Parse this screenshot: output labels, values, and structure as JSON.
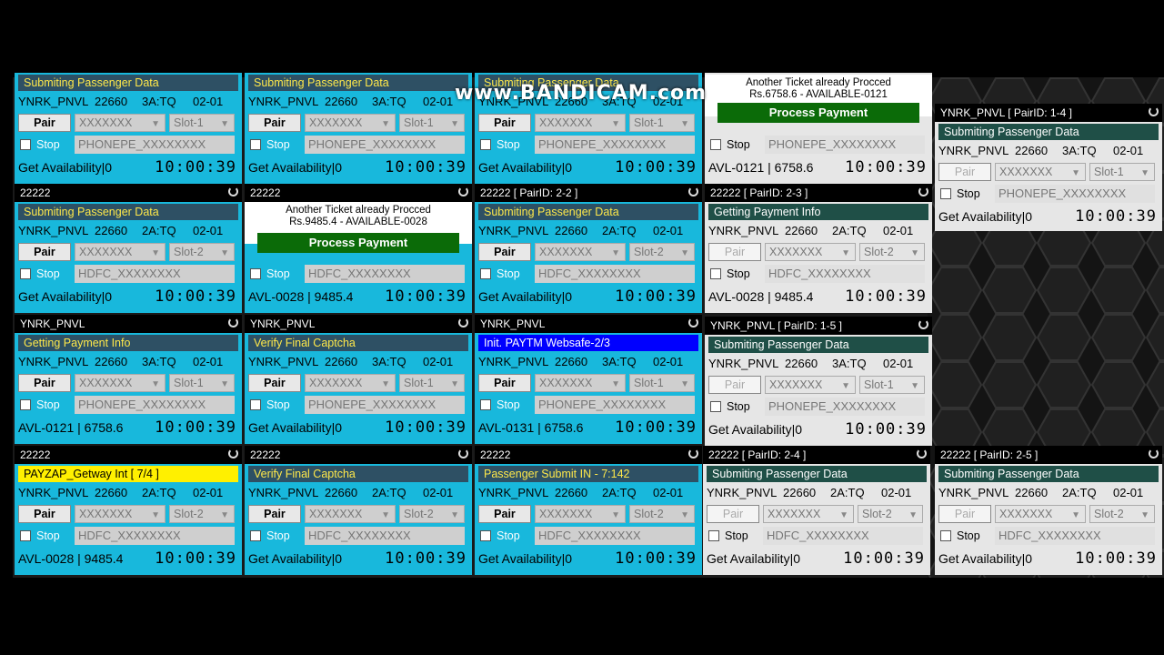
{
  "watermark": "www.BANDICAM.com",
  "panels": [
    {
      "title": "",
      "status": "Submiting Passenger Data",
      "station": "YNRK_PNVL",
      "train": "22660",
      "cls": "3A:TQ",
      "date": "02-01",
      "pair": "Pair",
      "user": "XXXXXXX",
      "slot": "Slot-1",
      "stop": "Stop",
      "bank": "PHONEPE_XXXXXXXX",
      "left": "Get Availability|0",
      "timer": "10:00:39"
    },
    {
      "title": "",
      "status": "Submiting Passenger Data",
      "station": "YNRK_PNVL",
      "train": "22660",
      "cls": "3A:TQ",
      "date": "02-01",
      "pair": "Pair",
      "user": "XXXXXXX",
      "slot": "Slot-1",
      "stop": "Stop",
      "bank": "PHONEPE_XXXXXXXX",
      "left": "Get Availability|0",
      "timer": "10:00:39"
    },
    {
      "title": "",
      "status": "Submiting Passenger Data",
      "station": "YNRK_PNVL",
      "train": "22660",
      "cls": "3A:TQ",
      "date": "02-01",
      "pair": "Pair",
      "user": "XXXXXXX",
      "slot": "Slot-1",
      "stop": "Stop",
      "bank": "PHONEPE_XXXXXXXX",
      "left": "Get Availability|0",
      "timer": "10:00:39"
    },
    {
      "title": "",
      "alert1": "Another Ticket already Procced",
      "alert2": "Rs.6758.6 - AVAILABLE-0121",
      "process": "Process Payment",
      "stop": "Stop",
      "bank": "PHONEPE_XXXXXXXX",
      "left": "AVL-0121 | 6758.6",
      "timer": "10:00:39"
    },
    {
      "title": "YNRK_PNVL [ PairID: 1-4 ]",
      "status": "Submiting Passenger Data",
      "station": "YNRK_PNVL",
      "train": "22660",
      "cls": "3A:TQ",
      "date": "02-01",
      "pair": "Pair",
      "user": "XXXXXXX",
      "slot": "Slot-1",
      "stop": "Stop",
      "bank": "PHONEPE_XXXXXXXX",
      "left": "Get Availability|0",
      "timer": "10:00:39"
    },
    {
      "title": "22222",
      "status": "Submiting Passenger Data",
      "station": "YNRK_PNVL",
      "train": "22660",
      "cls": "2A:TQ",
      "date": "02-01",
      "pair": "Pair",
      "user": "XXXXXXX",
      "slot": "Slot-2",
      "stop": "Stop",
      "bank": "HDFC_XXXXXXXX",
      "left": "Get Availability|0",
      "timer": "10:00:39"
    },
    {
      "title": "22222",
      "alert1": "Another Ticket already Procced",
      "alert2": "Rs.9485.4 - AVAILABLE-0028",
      "process": "Process Payment",
      "stop": "Stop",
      "bank": "HDFC_XXXXXXXX",
      "left": "AVL-0028 | 9485.4",
      "timer": "10:00:39"
    },
    {
      "title": "22222 [ PairID: 2-2 ]",
      "status": "Submiting Passenger Data",
      "station": "YNRK_PNVL",
      "train": "22660",
      "cls": "2A:TQ",
      "date": "02-01",
      "pair": "Pair",
      "user": "XXXXXXX",
      "slot": "Slot-2",
      "stop": "Stop",
      "bank": "HDFC_XXXXXXXX",
      "left": "Get Availability|0",
      "timer": "10:00:39"
    },
    {
      "title": "22222 [ PairID: 2-3 ]",
      "status": "Getting Payment Info",
      "station": "YNRK_PNVL",
      "train": "22660",
      "cls": "2A:TQ",
      "date": "02-01",
      "pair": "Pair",
      "user": "XXXXXXX",
      "slot": "Slot-2",
      "stop": "Stop",
      "bank": "HDFC_XXXXXXXX",
      "left": "AVL-0028 | 9485.4",
      "timer": "10:00:39"
    },
    {
      "title": "YNRK_PNVL",
      "status": "Getting Payment Info",
      "station": "YNRK_PNVL",
      "train": "22660",
      "cls": "3A:TQ",
      "date": "02-01",
      "pair": "Pair",
      "user": "XXXXXXX",
      "slot": "Slot-1",
      "stop": "Stop",
      "bank": "PHONEPE_XXXXXXXX",
      "left": "AVL-0121 | 6758.6",
      "timer": "10:00:39"
    },
    {
      "title": "YNRK_PNVL",
      "status": "Verify Final Captcha",
      "station": "YNRK_PNVL",
      "train": "22660",
      "cls": "3A:TQ",
      "date": "02-01",
      "pair": "Pair",
      "user": "XXXXXXX",
      "slot": "Slot-1",
      "stop": "Stop",
      "bank": "PHONEPE_XXXXXXXX",
      "left": "Get Availability|0",
      "timer": "10:00:39"
    },
    {
      "title": "YNRK_PNVL",
      "status": "Init. PAYTM Websafe-2/3",
      "station": "YNRK_PNVL",
      "train": "22660",
      "cls": "3A:TQ",
      "date": "02-01",
      "pair": "Pair",
      "user": "XXXXXXX",
      "slot": "Slot-1",
      "stop": "Stop",
      "bank": "PHONEPE_XXXXXXXX",
      "left": "AVL-0131 | 6758.6",
      "timer": "10:00:39"
    },
    {
      "title": "YNRK_PNVL [ PairID: 1-5 ]",
      "status": "Submiting Passenger Data",
      "station": "YNRK_PNVL",
      "train": "22660",
      "cls": "3A:TQ",
      "date": "02-01",
      "pair": "Pair",
      "user": "XXXXXXX",
      "slot": "Slot-1",
      "stop": "Stop",
      "bank": "PHONEPE_XXXXXXXX",
      "left": "Get Availability|0",
      "timer": "10:00:39"
    },
    {
      "title": "22222",
      "status": "PAYZAP_Getway Int [ 7/4 ]",
      "station": "YNRK_PNVL",
      "train": "22660",
      "cls": "2A:TQ",
      "date": "02-01",
      "pair": "Pair",
      "user": "XXXXXXX",
      "slot": "Slot-2",
      "stop": "Stop",
      "bank": "HDFC_XXXXXXXX",
      "left": "AVL-0028 | 9485.4",
      "timer": "10:00:39"
    },
    {
      "title": "22222",
      "status": "Verify Final Captcha",
      "station": "YNRK_PNVL",
      "train": "22660",
      "cls": "2A:TQ",
      "date": "02-01",
      "pair": "Pair",
      "user": "XXXXXXX",
      "slot": "Slot-2",
      "stop": "Stop",
      "bank": "HDFC_XXXXXXXX",
      "left": "Get Availability|0",
      "timer": "10:00:39"
    },
    {
      "title": "22222",
      "status": "Passenger Submit IN - 7:142",
      "station": "YNRK_PNVL",
      "train": "22660",
      "cls": "2A:TQ",
      "date": "02-01",
      "pair": "Pair",
      "user": "XXXXXXX",
      "slot": "Slot-2",
      "stop": "Stop",
      "bank": "HDFC_XXXXXXXX",
      "left": "Get Availability|0",
      "timer": "10:00:39"
    },
    {
      "title": "22222 [ PairID: 2-4 ]",
      "status": "Submiting Passenger Data",
      "station": "YNRK_PNVL",
      "train": "22660",
      "cls": "2A:TQ",
      "date": "02-01",
      "pair": "Pair",
      "user": "XXXXXXX",
      "slot": "Slot-2",
      "stop": "Stop",
      "bank": "HDFC_XXXXXXXX",
      "left": "Get Availability|0",
      "timer": "10:00:39"
    },
    {
      "title": "22222 [ PairID: 2-5 ]",
      "status": "Submiting Passenger Data",
      "station": "YNRK_PNVL",
      "train": "22660",
      "cls": "2A:TQ",
      "date": "02-01",
      "pair": "Pair",
      "user": "XXXXXXX",
      "slot": "Slot-2",
      "stop": "Stop",
      "bank": "HDFC_XXXXXXXX",
      "left": "Get Availability|0",
      "timer": "10:00:39"
    }
  ]
}
